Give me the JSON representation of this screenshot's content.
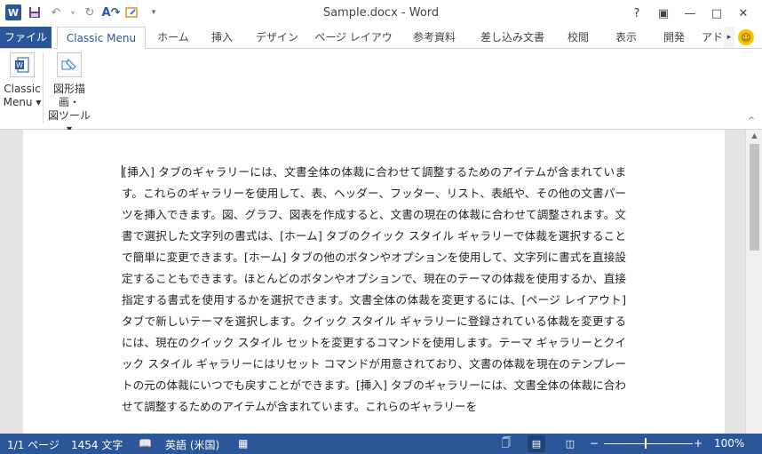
{
  "titlebar": {
    "title": "Sample.docx - Word",
    "app_logo": "W",
    "qat_icons": [
      "save-icon",
      "undo-icon",
      "redo-icon",
      "spelling-icon",
      "touch-mode-icon",
      "customize-qat-icon"
    ],
    "controls": [
      "?",
      "▣",
      "—",
      "□",
      "✕"
    ]
  },
  "tabs": [
    {
      "label": "ファイル"
    },
    {
      "label": "Classic Menu"
    },
    {
      "label": "ホーム"
    },
    {
      "label": "挿入"
    },
    {
      "label": "デザイン"
    },
    {
      "label": "ページ レイアウト"
    },
    {
      "label": "参考資料"
    },
    {
      "label": "差し込み文書"
    },
    {
      "label": "校閲"
    },
    {
      "label": "表示"
    },
    {
      "label": "開発"
    },
    {
      "label": "アド"
    }
  ],
  "ribbon": {
    "buttons": [
      {
        "line1": "Classic",
        "line2": "Menu ▾"
      },
      {
        "line1": "図形描画・",
        "line2": "図ツール ▾"
      }
    ]
  },
  "document": {
    "text": "[挿入] タブのギャラリーには、文書全体の体裁に合わせて調整するためのアイテムが含まれています。これらのギャラリーを使用して、表、ヘッダー、フッター、リスト、表紙や、その他の文書パーツを挿入できます。図、グラフ、図表を作成すると、文書の現在の体裁に合わせて調整されます。文書で選択した文字列の書式は、[ホーム] タブのクイック スタイル ギャラリーで体裁を選択することで簡単に変更できます。[ホーム] タブの他のボタンやオプションを使用して、文字列に書式を直接設定することもできます。ほとんどのボタンやオプションで、現在のテーマの体裁を使用するか、直接指定する書式を使用するかを選択できます。文書全体の体裁を変更するには、[ページ レイアウト] タブで新しいテーマを選択します。クイック スタイル ギャラリーに登録されている体裁を変更するには、現在のクイック スタイル セットを変更するコマンドを使用します。テーマ ギャラリーとクイック スタイル ギャラリーにはリセット コマンドが用意されており、文書の体裁を現在のテンプレートの元の体裁にいつでも戻すことができます。[挿入] タブのギャラリーには、文書全体の体裁に合わせて調整するためのアイテムが含まれています。これらのギャラリーを"
  },
  "statusbar": {
    "page": "1/1 ページ",
    "words": "1454 文字",
    "language": "英語 (米国)",
    "zoom_minus": "−",
    "zoom_plus": "+",
    "zoom_level": "100%",
    "zoom_fraction": 0.5
  },
  "colors": {
    "accent": "#2b579a",
    "file_tab": "#2b579a",
    "statusbar": "#2b579a"
  }
}
